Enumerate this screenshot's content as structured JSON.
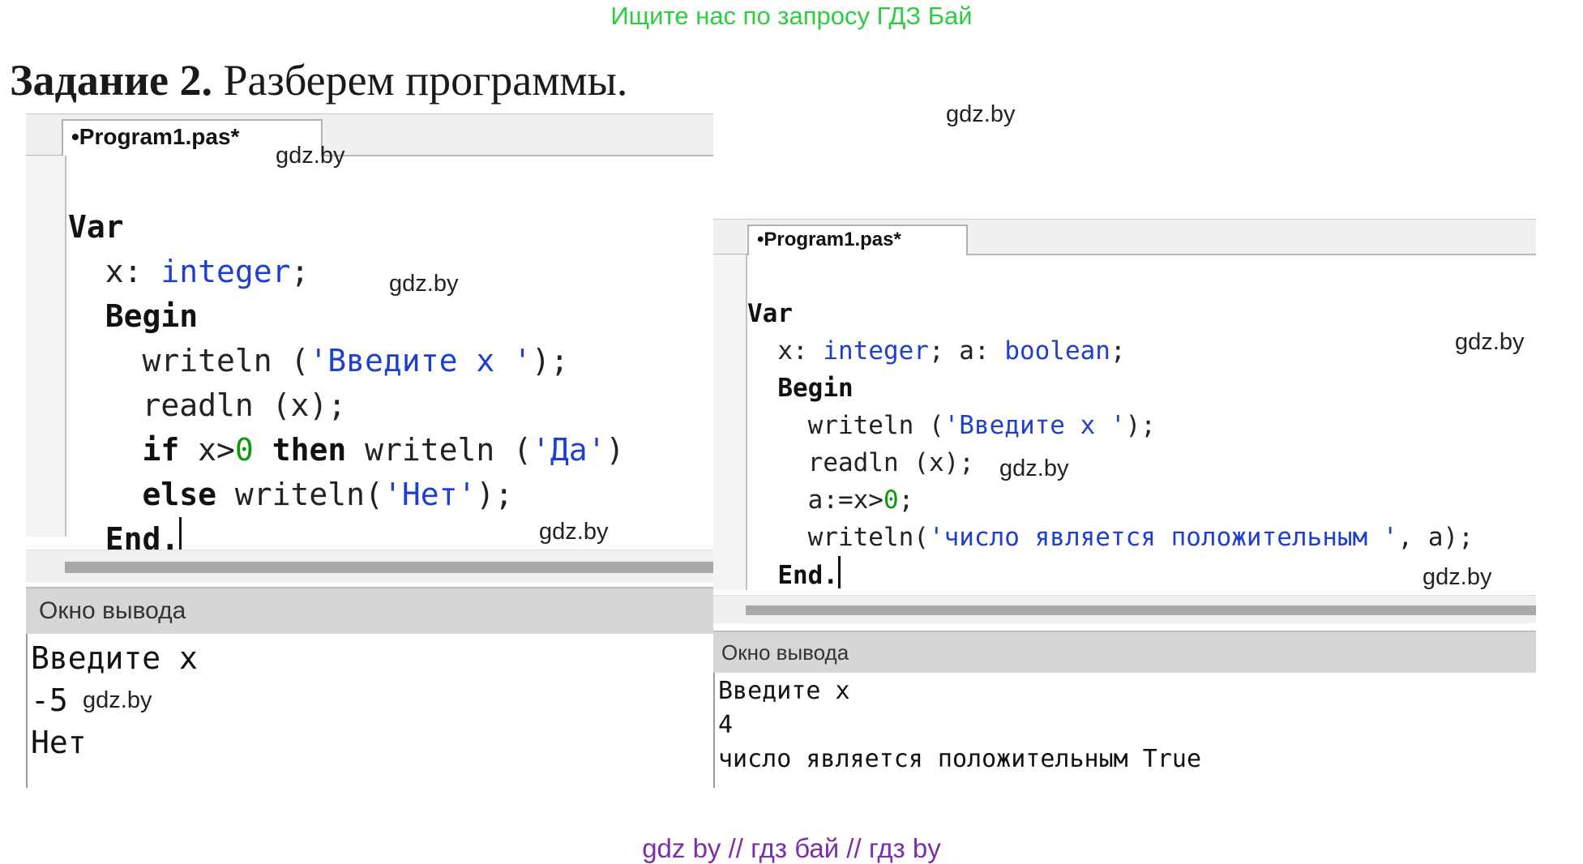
{
  "banner": "Ищите нас по запросу ГДЗ Бай",
  "task": {
    "number": "Задание 2.",
    "text": " Разберем программы."
  },
  "watermark": "gdz.by",
  "footer": "gdz by  //  гдз бай  //  гдз by",
  "left_ide": {
    "tab_label": "•Program1.pas*",
    "code": {
      "var_kw": "Var",
      "x_decl": "x: ",
      "int_type": "integer",
      "semi": ";",
      "begin_kw": "Begin",
      "writeln1": "writeln (",
      "prompt_str": "'Введите x '",
      "close1": ");",
      "readln": "readln (x);",
      "if_kw": "if",
      "cond": " x>",
      "zero": "0",
      "then_kw": " then",
      "writeln2": " writeln (",
      "da_str": "'Да'",
      "close2": ")",
      "else_kw": "else",
      "writeln3": " writeln(",
      "net_str": "'Нет'",
      "close3": ");",
      "end_kw": "End."
    },
    "output_title": "Окно вывода",
    "output_lines": [
      "Введите x",
      "-5",
      "Нет"
    ]
  },
  "right_ide": {
    "tab_label": "•Program1.pas*",
    "code": {
      "var_kw": "Var",
      "x_decl": "x: ",
      "int_type": "integer",
      "a_decl": "; a: ",
      "bool_type": "boolean",
      "semi": ";",
      "begin_kw": "Begin",
      "writeln1": "writeln (",
      "prompt_str": "'Введите x '",
      "close1": ");",
      "readln": "readln (x);",
      "assign": "a:=x>",
      "zero": "0",
      "assign_end": ";",
      "writeln2": "writeln(",
      "msg_str": "'число является положительным '",
      "close2": ", a);",
      "end_kw": "End."
    },
    "output_title": "Окно вывода",
    "output_lines": [
      "Введите x",
      "4",
      "число является положительным True"
    ]
  },
  "colors": {
    "banner": "#2ecc40",
    "footer": "#7b2fa8",
    "type_blue": "#1f3fd1",
    "number_green": "#0a9a0a"
  }
}
